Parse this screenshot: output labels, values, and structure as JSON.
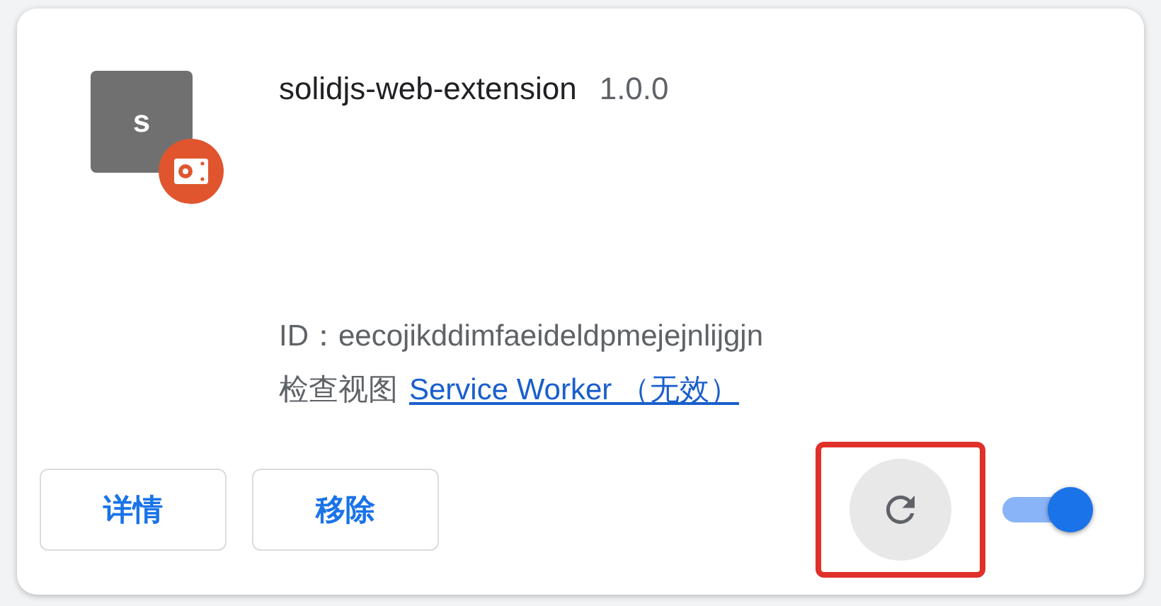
{
  "extension": {
    "icon_letter": "s",
    "name": "solidjs-web-extension",
    "version": "1.0.0",
    "id_label": "ID：",
    "id": "eecojikddimfaeideldpmejejnlijgjn",
    "inspect_label": "检查视图",
    "inspect_link": "Service Worker （无效）"
  },
  "buttons": [
    "详情",
    "移除"
  ],
  "reload": {
    "highlighted": true
  },
  "enabled": true
}
